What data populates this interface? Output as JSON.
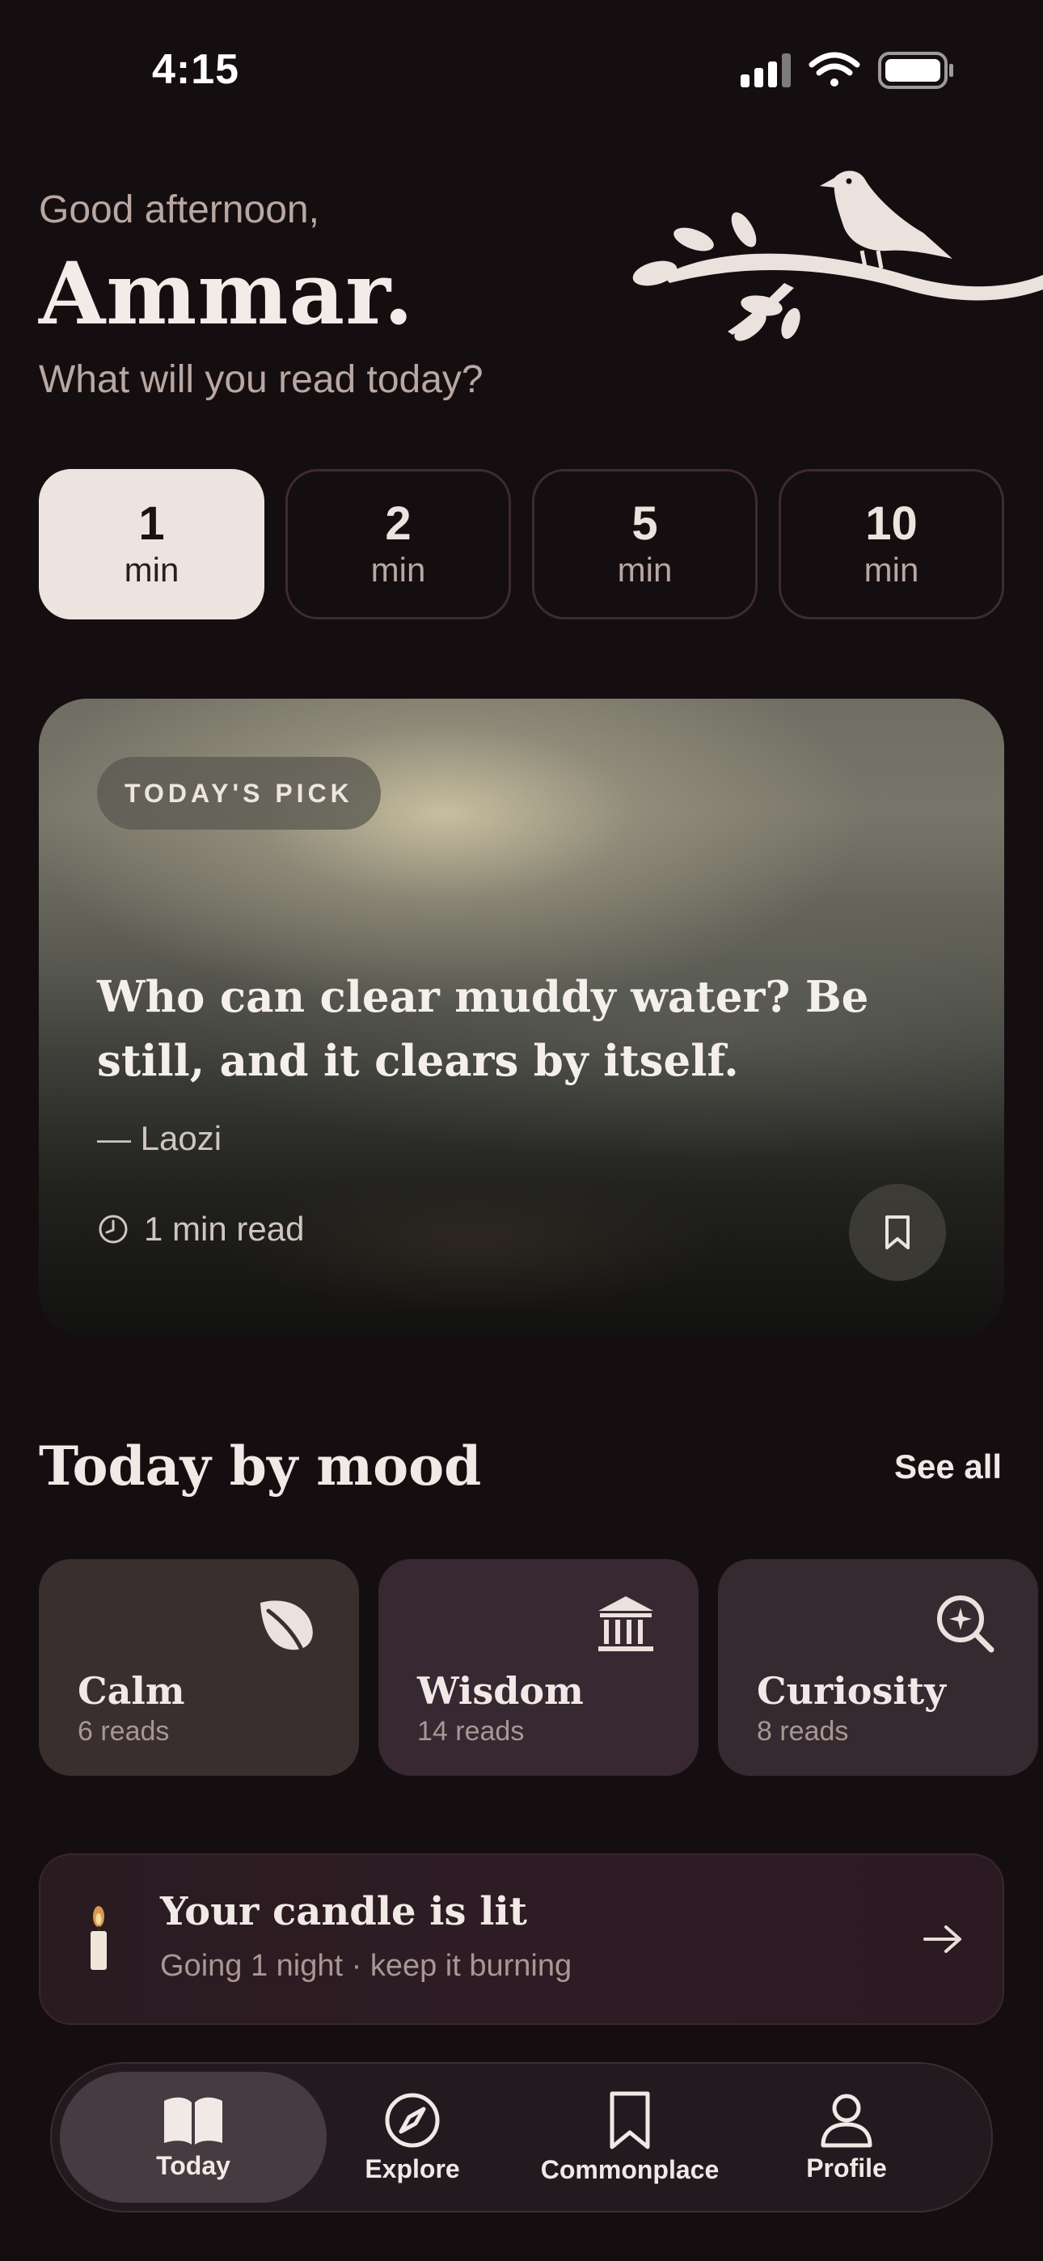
{
  "status_bar": {
    "time": "4:15"
  },
  "greeting": {
    "salutation": "Good afternoon,",
    "name": "Ammar.",
    "prompt": "What will you read today?"
  },
  "durations": [
    {
      "value": "1",
      "unit": "min",
      "selected": true
    },
    {
      "value": "2",
      "unit": "min",
      "selected": false
    },
    {
      "value": "5",
      "unit": "min",
      "selected": false
    },
    {
      "value": "10",
      "unit": "min",
      "selected": false
    }
  ],
  "todays_pick": {
    "badge": "TODAY'S PICK",
    "quote": "Who can clear muddy water? Be still, and it clears by itself.",
    "author": "— Laozi",
    "read_time": "1 min read"
  },
  "mood_section": {
    "title": "Today by mood",
    "see_all": "See all",
    "moods": [
      {
        "name": "Calm",
        "reads": "6 reads",
        "icon": "leaf-icon",
        "color": "#3a2f2f"
      },
      {
        "name": "Wisdom",
        "reads": "14 reads",
        "icon": "pillar-building-icon",
        "color": "#372831"
      },
      {
        "name": "Curiosity",
        "reads": "8 reads",
        "icon": "sparkle-magnifier-icon",
        "color": "#342a30"
      }
    ]
  },
  "candle": {
    "title": "Your candle is lit",
    "subtitle": "Going 1 night · keep it burning"
  },
  "tab_bar": {
    "tabs": [
      {
        "label": "Today",
        "icon": "open-book-icon",
        "active": true
      },
      {
        "label": "Explore",
        "icon": "compass-icon",
        "active": false
      },
      {
        "label": "Commonplace",
        "icon": "bookmark-icon",
        "active": false
      },
      {
        "label": "Profile",
        "icon": "person-icon",
        "active": false
      }
    ]
  },
  "colors": {
    "background": "#150e11",
    "text_primary": "#f1e9e6",
    "text_muted": "#b9a7a2",
    "pill_active": "#ede4e0"
  }
}
